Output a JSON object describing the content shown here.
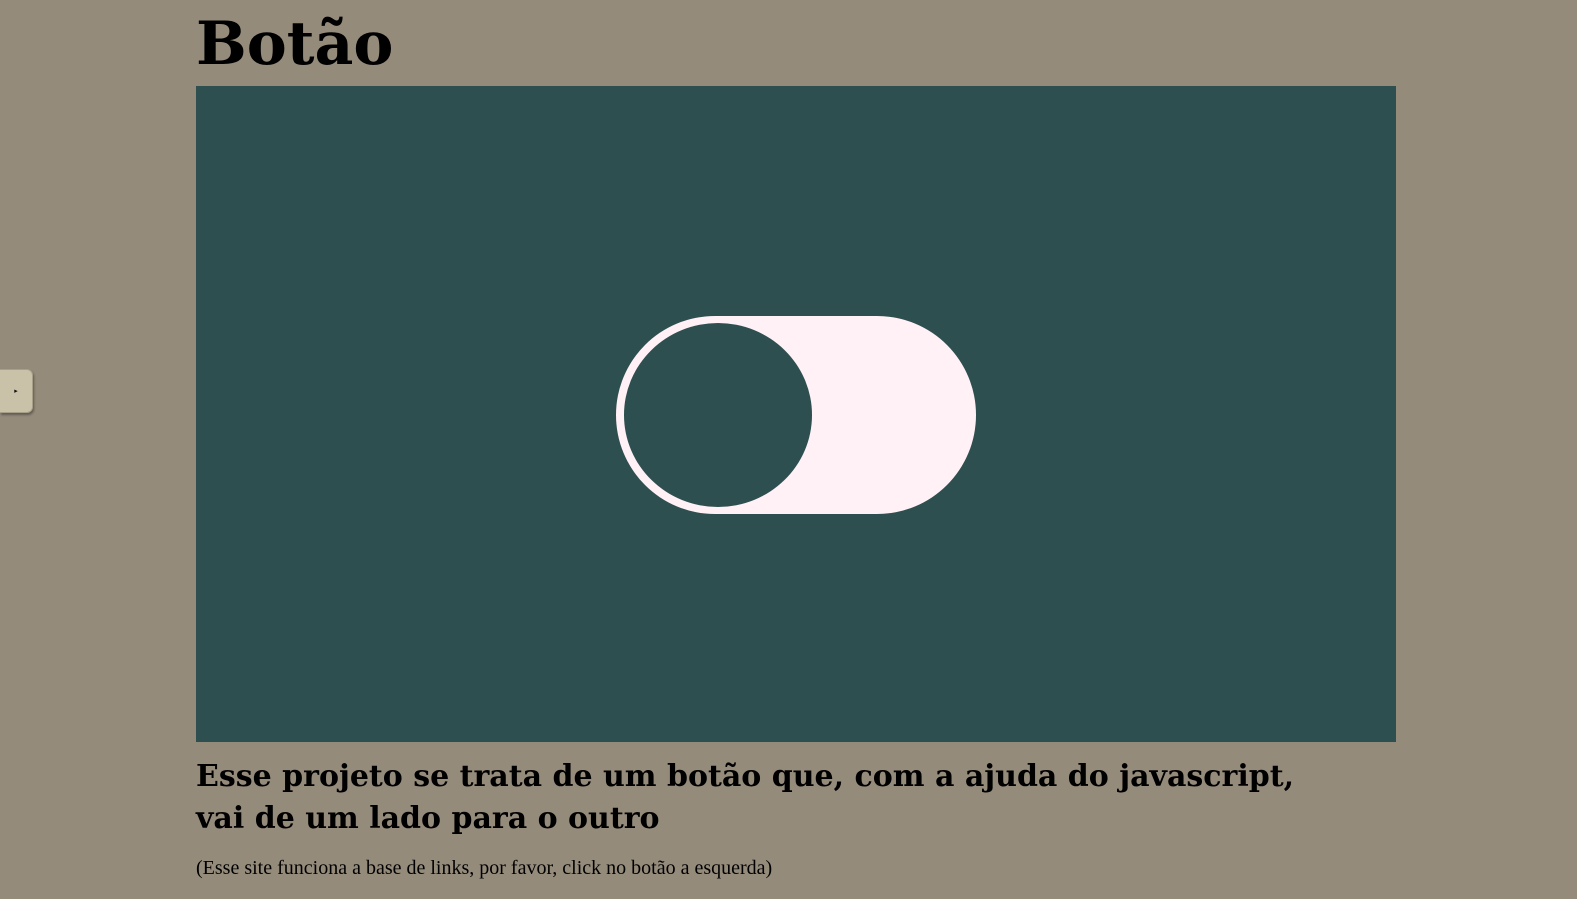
{
  "side_tab": {
    "arrow_glyph": "▸"
  },
  "header": {
    "title": "Botão"
  },
  "toggle": {
    "state": "off",
    "track_color": "#fff1f5",
    "knob_color": "#2e4f4f",
    "stage_color": "#2e4f4f"
  },
  "main": {
    "description": "Esse projeto se trata de um botão que, com a ajuda do javascript, vai de um lado para o outro",
    "note": "(Esse site funciona a base de links, por favor, click no botão a esquerda)"
  },
  "colors": {
    "page_background": "#958b7b",
    "tab_background": "#c9c1a8"
  }
}
